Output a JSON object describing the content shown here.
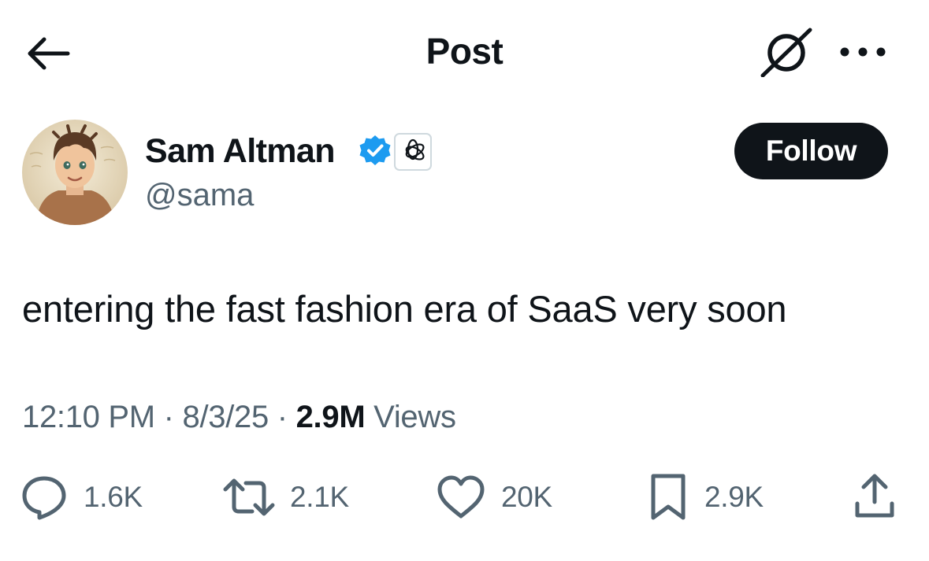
{
  "header": {
    "title": "Post",
    "icons": {
      "back": "arrow-left-icon",
      "grok": "grok-icon",
      "more": "more-horizontal-icon"
    }
  },
  "author": {
    "name": "Sam Altman",
    "handle": "@sama",
    "verified": true,
    "verified_color": "#1d9bf0",
    "affiliate_badge": "openai-logo-icon",
    "follow_label": "Follow"
  },
  "post": {
    "text": "entering the fast fashion era of SaaS very soon",
    "time": "12:10 PM",
    "separator": "·",
    "date": "8/3/25",
    "views_count": "2.9M",
    "views_label": "Views"
  },
  "actions": {
    "replies": "1.6K",
    "reposts": "2.1K",
    "likes": "20K",
    "bookmarks": "2.9K"
  },
  "colors": {
    "text_primary": "#0f1419",
    "text_secondary": "#536471",
    "follow_bg": "#0f1419",
    "verified": "#1d9bf0"
  }
}
